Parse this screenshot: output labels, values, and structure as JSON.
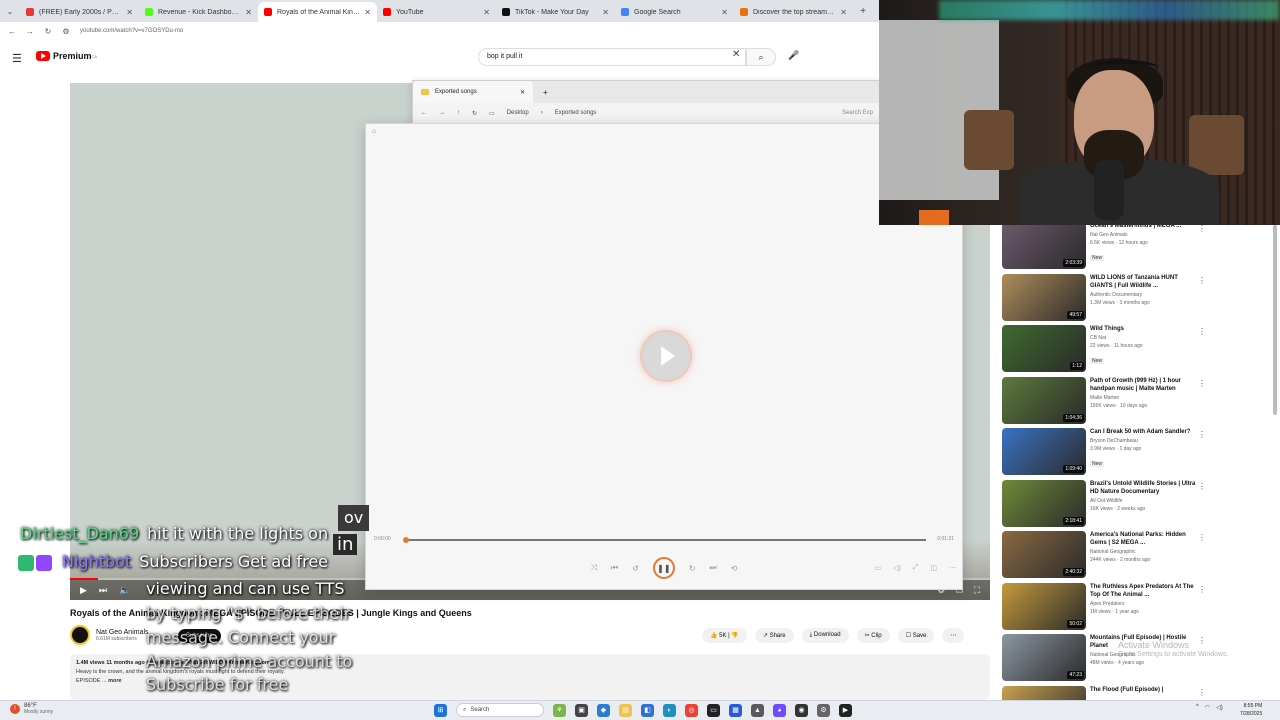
{
  "browser": {
    "tabs": [
      {
        "title": "(FREE) Early 2000s / Pharrell / C",
        "color": "#e53935"
      },
      {
        "title": "Revenue - Kick Dashboard",
        "color": "#53fc18"
      },
      {
        "title": "Royals of the Animal Kingdom",
        "color": "#ff0000",
        "active": true
      },
      {
        "title": "YouTube",
        "color": "#ff0000"
      },
      {
        "title": "TikTok - Make Your Day",
        "color": "#111111"
      },
      {
        "title": "Google Search",
        "color": "#4285f4"
      },
      {
        "title": "Discover the top streamed mu",
        "color": "#e8710a"
      }
    ],
    "url": "youtube.com/watch?v=v7GOSYDu-mo"
  },
  "youtube": {
    "logo_text": "Premium",
    "search_value": "bop it pull it",
    "video_title": "Royals of the Animal Kingdom: MEGA EPISODE | FULL EPISODES | Jungle Kings and Queens",
    "channel_name": "Nat Geo Animals",
    "channel_subs": "6.61M subscribers",
    "subscribe_label": "Subscribe",
    "actions": {
      "like": "5K",
      "share": "Share",
      "download": "Download",
      "clip": "Clip",
      "save": "Save"
    },
    "description": {
      "meta": "1.4M views  11 months ago  #MegaEpisode #NatGeoWILD #AnimalKingdom",
      "line": "Heavy is the crown, and the animal kingdom's royals must fight to defend their royalty.",
      "more_prefix": "EPISODE ...",
      "more": "more"
    }
  },
  "explorer": {
    "tab_title": "Exported songs",
    "crumb_1": "Desktop",
    "crumb_2": "Exported songs",
    "search_placeholder": "Search Exp"
  },
  "media_player": {
    "time_elapsed": "0:00:00",
    "time_total": "0:01:21",
    "progress": 0.0
  },
  "recommendations": [
    {
      "title": "Ocean's Masterminds | MEGA ...",
      "channel": "Nat Geo Animals",
      "stats": "6.5K views · 12 hours ago",
      "badge": "New",
      "duration": "2:03:39",
      "thumb": "#6d5a6e"
    },
    {
      "title": "WILD LIONS of Tanzania HUNT GIANTS | Full Wildlife ...",
      "channel": "Authentic Documentary",
      "stats": "1.3M views · 3 months ago",
      "badge": "",
      "duration": "49:57",
      "thumb": "#b08d5c"
    },
    {
      "title": "Wild Things",
      "channel": "CB Nat",
      "stats": "22 views · 11 hours ago",
      "badge": "New",
      "duration": "1:12",
      "thumb": "#3f6b2e"
    },
    {
      "title": "Path of Growth (999 Hz) | 1 hour handpan music | Malte Marten",
      "channel": "Malte Marten",
      "stats": "155K views · 10 days ago",
      "badge": "",
      "duration": "1:04:36",
      "thumb": "#5c7a3c"
    },
    {
      "title": "Can I Break 50 with Adam Sandler?",
      "channel": "Bryson DeChambeau",
      "stats": "3.9M views · 1 day ago",
      "badge": "New",
      "duration": "1:09:40",
      "thumb": "#3b73c4"
    },
    {
      "title": "Brazil's Untold Wildlife Stories | Ultra HD Nature Documentary",
      "channel": "All Out Wildlife",
      "stats": "16K views · 2 weeks ago",
      "badge": "",
      "duration": "2:18:41",
      "thumb": "#6f8a3a"
    },
    {
      "title": "America's National Parks: Hidden Gems | S2 MEGA ...",
      "channel": "National Geographic",
      "stats": "244K views · 2 months ago",
      "badge": "",
      "duration": "2:40:32",
      "thumb": "#8a6a42"
    },
    {
      "title": "The Ruthless Apex Predators At The Top Of The Animal ...",
      "channel": "Apex Predators",
      "stats": "1M views · 1 year ago",
      "badge": "",
      "duration": "50:02",
      "thumb": "#c49a3c"
    },
    {
      "title": "Mountains (Full Episode) | Hostile Planet",
      "channel": "National Geographic",
      "stats": "48M views · 4 years ago",
      "badge": "",
      "duration": "47:23",
      "thumb": "#8d97a3"
    },
    {
      "title": "The Flood (Full Episode) |",
      "channel": "",
      "stats": "",
      "badge": "",
      "duration": "",
      "thumb": "#c9a050"
    }
  ],
  "chat": {
    "user1": "Dirtiest_Dan69",
    "msg1": "hit it with the lights on",
    "user2": "Nightbot",
    "msg2": "Subscribers Get ad free",
    "msg2_cont": "viewing and can use TTS",
    "msg3": "by typing \"$\" before their",
    "msg4": "message. Connect your",
    "msg5": "Amazon prime account to",
    "msg6": "Subscribe for free",
    "overlay_1": "ov",
    "overlay_2": "in"
  },
  "taskbar": {
    "temp": "86°F",
    "weather": "Mostly sunny",
    "search": "Search",
    "time": "8:55 PM",
    "date": "7/28/2025"
  },
  "watermark": {
    "line1": "Activate Windows",
    "line2": "Go to Settings to activate Windows."
  }
}
